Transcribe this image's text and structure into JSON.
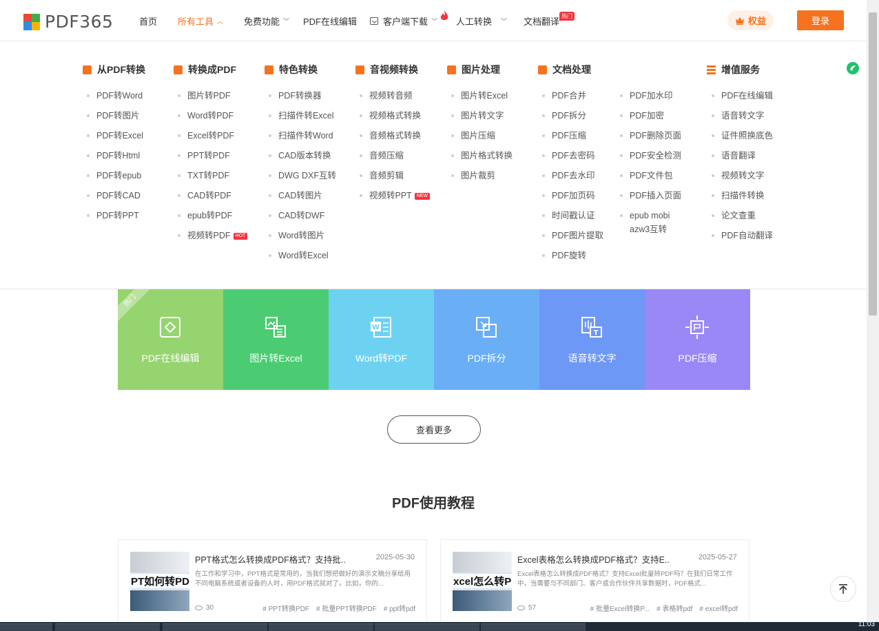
{
  "header": {
    "logo_text": "PDF365",
    "nav": [
      {
        "label": "首页",
        "chevron": false,
        "active": false
      },
      {
        "label": "所有工具",
        "chevron": true,
        "active": true
      },
      {
        "label": "免费功能",
        "chevron": true,
        "active": false
      },
      {
        "label": "PDF在线编辑",
        "chevron": false,
        "active": false
      },
      {
        "label": "客户端下载",
        "chevron": true,
        "active": false
      },
      {
        "label": "人工转换",
        "chevron": true,
        "active": false
      },
      {
        "label": "文档翻译",
        "chevron": false,
        "active": false
      }
    ],
    "hot_tag": "热门",
    "quanyi_label": "权益",
    "login_label": "登录",
    "accent_color": "#f5731f"
  },
  "menu": {
    "columns": [
      {
        "title": "从PDF转换",
        "icon": "pdf-convert-icon",
        "items": [
          "PDF转Word",
          "PDF转图片",
          "PDF转Excel",
          "PDF转Html",
          "PDF转epub",
          "PDF转CAD",
          "PDF转PPT"
        ]
      },
      {
        "title": "转换成PDF",
        "icon": "to-pdf-icon",
        "items": [
          "图片转PDF",
          "Word转PDF",
          "Excel转PDF",
          "PPT转PDF",
          "TXT转PDF",
          "CAD转PDF",
          "epub转PDF",
          "视频转PDF"
        ],
        "badge_item": 7,
        "badge": "HOT"
      },
      {
        "title": "特色转换",
        "icon": "shield-icon",
        "items": [
          "PDF转换器",
          "扫描件转Excel",
          "扫描件转Word",
          "CAD版本转换",
          "DWG DXF互转",
          "CAD转图片",
          "CAD转DWF",
          "Word转图片",
          "Word转Excel"
        ]
      },
      {
        "title": "音视频转换",
        "icon": "video-icon",
        "items": [
          "视频转音频",
          "视频格式转换",
          "音频格式转换",
          "音频压缩",
          "音频剪辑",
          "视频转PPT"
        ],
        "badge_item": 5,
        "badge": "NEW"
      },
      {
        "title": "图片处理",
        "icon": "image-icon",
        "items": [
          "图片转Excel",
          "图片转文字",
          "图片压缩",
          "图片格式转换",
          "图片裁剪"
        ]
      },
      {
        "title": "文档处理",
        "icon": "document-icon",
        "items": [
          "PDF合并",
          "PDF拆分",
          "PDF压缩",
          "PDF去密码",
          "PDF去水印",
          "PDF加页码",
          "时间戳认证",
          "PDF图片提取",
          "PDF旋转"
        ]
      },
      {
        "title": "",
        "icon": "",
        "items": [
          "PDF加水印",
          "PDF加密",
          "PDF删除页面",
          "PDF安全检测",
          "PDF文件包",
          "PDF插入页面",
          "epub mobi azw3互转"
        ]
      },
      {
        "title": "增值服务",
        "icon": "list-icon",
        "items": [
          "PDF在线编辑",
          "语音转文字",
          "证件照换底色",
          "语音翻译",
          "视频转文字",
          "扫描件转换",
          "论文查重",
          "PDF自动翻译"
        ]
      }
    ]
  },
  "tiles": [
    {
      "label": "PDF在线编辑",
      "color": "#95d46f",
      "icon": "edit-icon"
    },
    {
      "label": "图片转Excel",
      "color": "#4ccc72",
      "icon": "image-to-excel-icon"
    },
    {
      "label": "Word转PDF",
      "color": "#6dd2f1",
      "icon": "word-icon"
    },
    {
      "label": "PDF拆分",
      "color": "#6aaef6",
      "icon": "split-icon"
    },
    {
      "label": "语音转文字",
      "color": "#6e98f6",
      "icon": "voice-to-text-icon"
    },
    {
      "label": "PDF压缩",
      "color": "#9a88f6",
      "icon": "compress-icon"
    }
  ],
  "tile_ribbon": "热门",
  "more_button": "查看更多",
  "section_title": "PDF使用教程",
  "articles": [
    {
      "thumb_text": "PT如何转PD",
      "title": "PPT格式怎么转换成PDF格式？支持批...",
      "date": "2025-05-30",
      "desc": "在工作和学习中，PPT格式是常用的，当我们想把做好的演示文稿分享给用不同电脑系统或者设备的人时，用PDF格式就对了。比如，你的...",
      "views": "30",
      "tags": [
        "# PPT转换PDF",
        "# 批量PPT转换PDF",
        "# ppt转pdf"
      ]
    },
    {
      "thumb_text": "xcel怎么转PD",
      "title": "Excel表格怎么转换成PDF格式？支持E...",
      "date": "2025-05-27",
      "desc": "Excel表格怎么转换成PDF格式？支持Excel批量转PDF吗？在我们日常工作中，当需要与不同部门、客户或合作伙伴共享数据时，PDF格式...",
      "views": "57",
      "tags": [
        "# 批量Excel转换P...",
        "# 表格转pdf",
        "# excel转pdf"
      ]
    }
  ],
  "taskbar": {
    "clock": "11:03"
  }
}
